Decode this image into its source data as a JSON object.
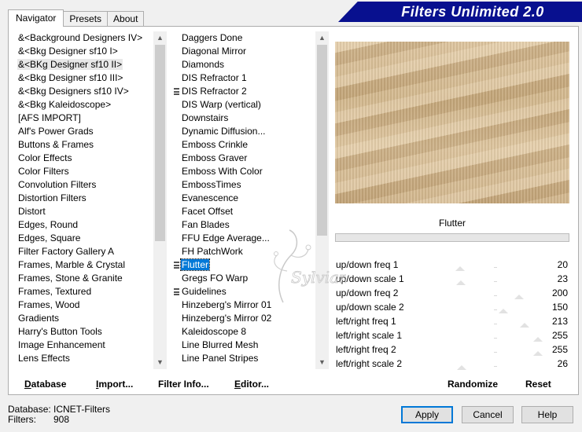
{
  "tabs": [
    {
      "label": "Navigator",
      "active": true
    },
    {
      "label": "Presets",
      "active": false
    },
    {
      "label": "About",
      "active": false
    }
  ],
  "title": "Filters Unlimited 2.0",
  "categories": [
    "&<Background Designers IV>",
    "&<Bkg Designer sf10 I>",
    "&<BKg Designer sf10 II>",
    "&<Bkg Designer sf10 III>",
    "&<Bkg Designers sf10 IV>",
    "&<Bkg Kaleidoscope>",
    "[AFS IMPORT]",
    "Alf's Power Grads",
    "Buttons & Frames",
    "Color Effects",
    "Color Filters",
    "Convolution Filters",
    "Distortion Filters",
    "Distort",
    "Edges, Round",
    "Edges, Square",
    "Filter Factory Gallery A",
    "Frames, Marble & Crystal",
    "Frames, Stone & Granite",
    "Frames, Textured",
    "Frames, Wood",
    "Gradients",
    "Harry's Button Tools",
    "Image Enhancement",
    "Lens Effects"
  ],
  "highlighted_category_index": 2,
  "filters": [
    {
      "label": "Daggers Done",
      "mark": false
    },
    {
      "label": "Diagonal Mirror",
      "mark": false
    },
    {
      "label": "Diamonds",
      "mark": false
    },
    {
      "label": "DIS Refractor 1",
      "mark": false
    },
    {
      "label": "DIS Refractor 2",
      "mark": true
    },
    {
      "label": "DIS Warp (vertical)",
      "mark": false
    },
    {
      "label": "Downstairs",
      "mark": false
    },
    {
      "label": "Dynamic Diffusion...",
      "mark": false
    },
    {
      "label": "Emboss Crinkle",
      "mark": false
    },
    {
      "label": "Emboss Graver",
      "mark": false
    },
    {
      "label": "Emboss With Color",
      "mark": false
    },
    {
      "label": "EmbossTimes",
      "mark": false
    },
    {
      "label": "Evanescence",
      "mark": false
    },
    {
      "label": "Facet Offset",
      "mark": false
    },
    {
      "label": "Fan Blades",
      "mark": false
    },
    {
      "label": "FFU Edge Average...",
      "mark": false
    },
    {
      "label": "FH PatchWork",
      "mark": false
    },
    {
      "label": "Flutter",
      "mark": true
    },
    {
      "label": "Gregs FO Warp",
      "mark": false
    },
    {
      "label": "Guidelines",
      "mark": true
    },
    {
      "label": "Hinzeberg's Mirror 01",
      "mark": false
    },
    {
      "label": "Hinzeberg's Mirror 02",
      "mark": false
    },
    {
      "label": "Kaleidoscope 8",
      "mark": false
    },
    {
      "label": "Line Blurred Mesh",
      "mark": false
    },
    {
      "label": "Line Panel Stripes",
      "mark": false
    }
  ],
  "selected_filter_index": 17,
  "filter_name": "Flutter",
  "params": [
    {
      "label": "up/down freq 1",
      "value": "20",
      "level": 0.08
    },
    {
      "label": "up/down scale 1",
      "value": "23",
      "level": 0.09
    },
    {
      "label": "up/down freq 2",
      "value": "200",
      "level": 0.78
    },
    {
      "label": "up/down scale 2",
      "value": "150",
      "level": 0.59
    },
    {
      "label": "left/right freq 1",
      "value": "213",
      "level": 0.84
    },
    {
      "label": "left/right scale 1",
      "value": "255",
      "level": 1.0
    },
    {
      "label": "left/right freq 2",
      "value": "255",
      "level": 1.0
    },
    {
      "label": "left/right scale 2",
      "value": "26",
      "level": 0.1
    }
  ],
  "left_buttons": [
    {
      "name": "database-button",
      "label": "Database",
      "underline": "D",
      "rest": "atabase"
    },
    {
      "name": "import-button",
      "label": "Import...",
      "underline": "I",
      "rest": "mport..."
    },
    {
      "name": "filter-info-button",
      "label": "Filter Info...",
      "underline": "",
      "rest": "Filter Info..."
    },
    {
      "name": "editor-button",
      "label": "Editor...",
      "underline": "E",
      "rest": "ditor..."
    }
  ],
  "randomize_label": "Randomize",
  "reset_label": "Reset",
  "status": {
    "database_key": "Database:",
    "database_value": "ICNET-Filters",
    "filters_key": "Filters:",
    "filters_value": "908"
  },
  "buttons": {
    "apply": "Apply",
    "cancel": "Cancel",
    "help": "Help"
  },
  "watermark_text": "Sylviane"
}
